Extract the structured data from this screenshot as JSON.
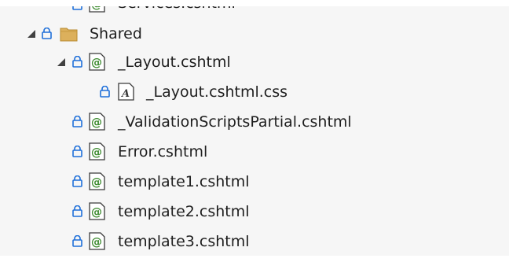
{
  "tree": {
    "items": [
      {
        "label": "Services.cshtml",
        "icon": "razor-page-icon",
        "expander": "none",
        "locked": true
      },
      {
        "label": "Shared",
        "icon": "folder-icon",
        "expander": "expanded",
        "locked": true
      },
      {
        "label": "_Layout.cshtml",
        "icon": "razor-page-icon",
        "expander": "expanded",
        "locked": true
      },
      {
        "label": "_Layout.cshtml.css",
        "icon": "css-file-icon",
        "expander": "none",
        "locked": true
      },
      {
        "label": "_ValidationScriptsPartial.cshtml",
        "icon": "razor-page-icon",
        "expander": "none",
        "locked": true
      },
      {
        "label": "Error.cshtml",
        "icon": "razor-page-icon",
        "expander": "none",
        "locked": true
      },
      {
        "label": "template1.cshtml",
        "icon": "razor-page-icon",
        "expander": "none",
        "locked": true
      },
      {
        "label": "template2.cshtml",
        "icon": "razor-page-icon",
        "expander": "none",
        "locked": true
      },
      {
        "label": "template3.cshtml",
        "icon": "razor-page-icon",
        "expander": "none",
        "locked": true
      }
    ]
  },
  "colors": {
    "lock": "#1e6fd9",
    "razor_green": "#3c8a2e",
    "folder": "#dcb05c",
    "text": "#1e1e1e",
    "background": "#f6f6f6"
  }
}
